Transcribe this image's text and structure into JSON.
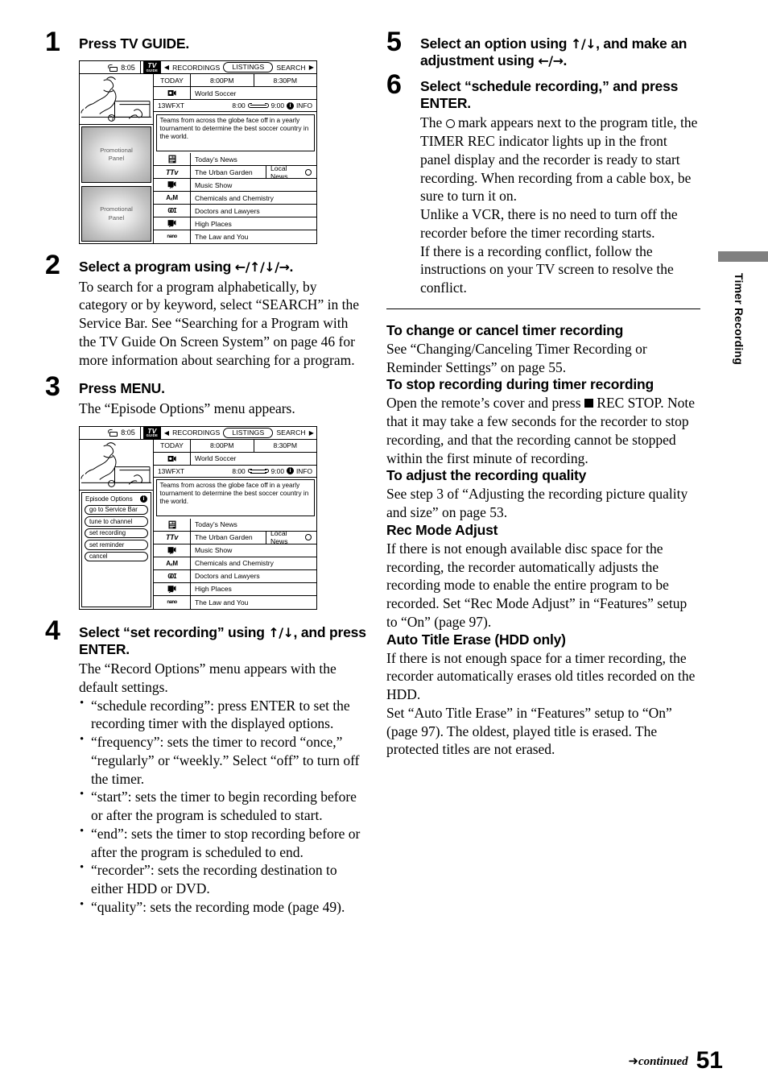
{
  "page": {
    "number": "51",
    "continued_label": "continued",
    "continued_arrow": "➜",
    "side_tab_label": "Timer Recording"
  },
  "left_column": {
    "steps": [
      {
        "num": "1",
        "title": "Press TV GUIDE."
      },
      {
        "num": "2",
        "title_prefix": "Select a program using ",
        "title_keys": "←/↑/↓/→",
        "title_suffix": ".",
        "body": "To search for a program alphabetically, by category or by keyword, select “SEARCH” in the Service Bar. See “Searching for a Program with the TV Guide On Screen System” on page 46 for more information about searching for a program."
      },
      {
        "num": "3",
        "title": "Press MENU.",
        "body": "The “Episode Options” menu appears."
      },
      {
        "num": "4",
        "title_prefix": "Select “set recording” using ",
        "title_keys": "↑/↓",
        "title_suffix": ", and press ENTER.",
        "body": "The “Record Options” menu appears with the default settings.",
        "bullets": [
          "“schedule recording”: press ENTER to set the recording timer with the displayed options.",
          "“frequency”: sets the timer to record “once,” “regularly” or “weekly.” Select “off” to turn off the timer.",
          "“start”: sets the timer to begin recording before or after the program is scheduled to start.",
          "“end”: sets the timer to stop recording before or after the program is scheduled to end.",
          "“recorder”: sets the recording destination to either HDD or DVD.",
          "“quality”: sets the recording mode (page 49)."
        ]
      }
    ]
  },
  "right_column": {
    "steps": [
      {
        "num": "5",
        "title_prefix": "Select an option using ",
        "title_keys": "↑/↓",
        "title_mid": ", and make an adjustment using ",
        "title_keys2": "←/→",
        "title_suffix": "."
      },
      {
        "num": "6",
        "title": "Select “schedule recording,” and press ENTER.",
        "body_1_pre": "The ",
        "body_1_post": " mark appears next to the program title, the TIMER REC indicator lights up in the front panel display and the recorder is ready to start recording. When recording from a cable box, be sure to turn it on.",
        "body_2": "Unlike a VCR, there is no need to turn off the recorder before the timer recording starts.",
        "body_3": "If there is a recording conflict, follow the instructions on your TV screen to resolve the conflict."
      }
    ],
    "sections": [
      {
        "heading": "To change or cancel timer recording",
        "body": "See “Changing/Canceling Timer Recording or Reminder Settings” on page 55."
      },
      {
        "heading": "To stop recording during timer recording",
        "body_pre": "Open the remote’s cover and press ",
        "body_post": " REC STOP. Note that it may take a few seconds for the recorder to stop recording, and that the recording cannot be stopped within the first minute of recording."
      },
      {
        "heading": "To adjust the recording quality",
        "body": "See step 3 of “Adjusting the recording picture quality and size” on page 53."
      },
      {
        "heading": "Rec Mode Adjust",
        "body": "If there is not enough available disc space for the recording, the recorder automatically adjusts the recording mode to enable the entire program to be recorded. Set “Rec Mode Adjust” in “Features” setup to “On” (page 97)."
      },
      {
        "heading": "Auto Title Erase (HDD only)",
        "body": "If there is not enough space for a timer recording, the recorder automatically erases old titles recorded on the HDD.\nSet “Auto Title Erase” in “Features” setup to “On” (page 97). The oldest, played title is erased. The protected titles are not erased."
      }
    ]
  },
  "tv_screen": {
    "clock": "8:05",
    "logo_line1": "TV",
    "logo_line2": "GUIDE",
    "service_bar": {
      "left_arrow": "◀",
      "right_arrow": "▶",
      "recordings": "RECORDINGS",
      "listings": "LISTINGS",
      "search": "SEARCH"
    },
    "promo_panel_label": "Promotional\nPanel",
    "grid_header": {
      "day": "TODAY",
      "slot1": "8:00PM",
      "slot2": "8:30PM"
    },
    "highlight_row": {
      "channel_glyph": "📹",
      "program": "World Soccer"
    },
    "info_bar": {
      "channel": "13WFXT",
      "start": "8:00",
      "end": "9:00",
      "info_label": "INFO",
      "info_glyph": "i"
    },
    "description": "Teams from across the globe face off in a yearly tournament to determine the best soccer country in the world.",
    "rows": [
      {
        "logo": "☷",
        "logo_style": "glyph-img",
        "program": "Today’s News"
      },
      {
        "logo": "TTv",
        "logo_style": "chlogo italic",
        "program": "The Urban Garden",
        "program2": "Local News",
        "has_rec_mark": true
      },
      {
        "logo": "♫",
        "logo_style": "glyph-img",
        "program": "Music Show"
      },
      {
        "logo": "AₓM",
        "logo_style": "chlogo",
        "program": "Chemicals and Chemistry"
      },
      {
        "logo": "GDI",
        "logo_style": "chlogo blocky",
        "program": "Doctors and Lawyers"
      },
      {
        "logo": "▤",
        "logo_style": "glyph-img",
        "program": "High Places"
      },
      {
        "logo": "nano",
        "logo_style": "chlogo tiny",
        "program": "The Law and You"
      }
    ],
    "episode_options": {
      "title": "Episode Options",
      "info_glyph": "i",
      "buttons": [
        "go to Service Bar",
        "tune to channel",
        "set recording",
        "set reminder",
        "cancel"
      ]
    }
  }
}
